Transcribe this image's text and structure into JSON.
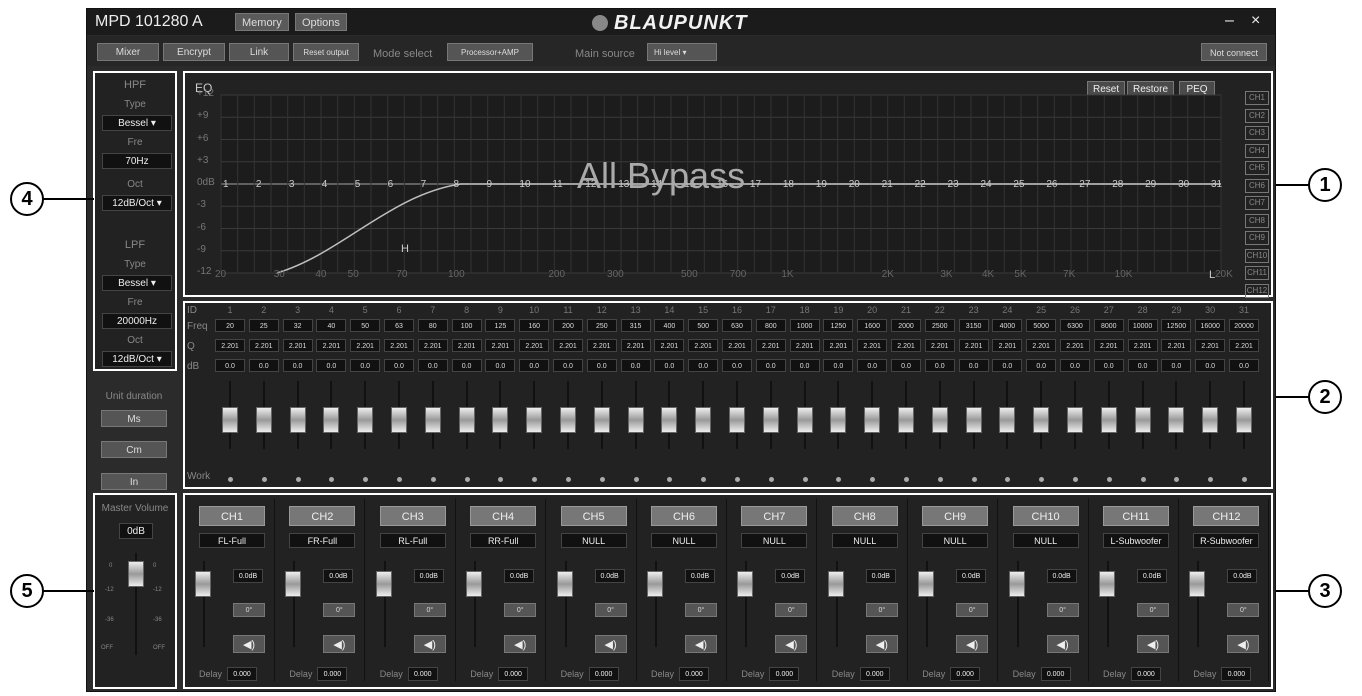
{
  "window": {
    "title": "MPD 101280 A",
    "menu": [
      "Memory",
      "Options"
    ],
    "brand": "BLAUPUNKT",
    "controls": [
      "–",
      "×"
    ]
  },
  "toolbar": {
    "buttons": [
      "Mixer",
      "Encrypt",
      "Link",
      "Reset output"
    ],
    "mode_select_label": "Mode select",
    "mode_value": "Processor+AMP",
    "main_source_label": "Main source",
    "main_source_value": "Hi level",
    "connection_status": "Not connect"
  },
  "crossover": {
    "hpf_title": "HPF",
    "hpf_type_label": "Type",
    "hpf_type": "Bessel",
    "hpf_fre_label": "Fre",
    "hpf_fre": "70Hz",
    "hpf_oct_label": "Oct",
    "hpf_oct": "12dB/Oct",
    "lpf_title": "LPF",
    "lpf_type_label": "Type",
    "lpf_type": "Bessel",
    "lpf_fre_label": "Fre",
    "lpf_fre": "20000Hz",
    "lpf_oct_label": "Oct",
    "lpf_oct": "12dB/Oct"
  },
  "unit_duration": {
    "label": "Unit duration",
    "options": [
      "Ms",
      "Cm",
      "In"
    ]
  },
  "master": {
    "label": "Master Volume",
    "value": "0dB",
    "scale_left": [
      "0",
      "-12",
      "-36",
      "OFF"
    ],
    "scale_right": [
      "0",
      "-12",
      "-36",
      "OFF"
    ]
  },
  "eq": {
    "label": "EQ",
    "buttons": [
      "Reset",
      "Restore",
      "PEQ"
    ],
    "overlay": "All Bypass",
    "y_ticks": [
      "+12",
      "+9",
      "+6",
      "+3",
      "0dB",
      "-3",
      "-6",
      "-9",
      "-12"
    ],
    "x_ticks": [
      "20",
      "30",
      "40",
      "50",
      "70",
      "100",
      "200",
      "300",
      "500",
      "700",
      "1K",
      "2K",
      "3K",
      "4K",
      "5K",
      "7K",
      "10K",
      "20K"
    ],
    "band_numbers": [
      "1",
      "2",
      "3",
      "4",
      "5",
      "6",
      "7",
      "8",
      "9",
      "10",
      "11",
      "12",
      "13",
      "14",
      "15",
      "16",
      "17",
      "18",
      "19",
      "20",
      "21",
      "22",
      "23",
      "24",
      "25",
      "26",
      "27",
      "28",
      "29",
      "30",
      "31"
    ],
    "marker_h": "H",
    "marker_l": "L",
    "channels": [
      "CH1",
      "CH2",
      "CH3",
      "CH4",
      "CH5",
      "CH6",
      "CH7",
      "CH8",
      "CH9",
      "CH10",
      "CH11",
      "CH12"
    ]
  },
  "bands": {
    "row_labels": [
      "ID",
      "Freq",
      "Q",
      "dB",
      "Work"
    ],
    "freq": [
      "20",
      "25",
      "32",
      "40",
      "50",
      "63",
      "80",
      "100",
      "125",
      "160",
      "200",
      "250",
      "315",
      "400",
      "500",
      "630",
      "800",
      "1000",
      "1250",
      "1600",
      "2000",
      "2500",
      "3150",
      "4000",
      "5000",
      "6300",
      "8000",
      "10000",
      "12500",
      "16000",
      "20000"
    ],
    "q": "2.201",
    "db": "0.0"
  },
  "channels": [
    {
      "name": "CH1",
      "route": "FL-Full",
      "gain": "0.0dB",
      "delay": "0.000"
    },
    {
      "name": "CH2",
      "route": "FR-Full",
      "gain": "0.0dB",
      "delay": "0.000"
    },
    {
      "name": "CH3",
      "route": "RL-Full",
      "gain": "0.0dB",
      "delay": "0.000"
    },
    {
      "name": "CH4",
      "route": "RR-Full",
      "gain": "0.0dB",
      "delay": "0.000"
    },
    {
      "name": "CH5",
      "route": "NULL",
      "gain": "0.0dB",
      "delay": "0.000"
    },
    {
      "name": "CH6",
      "route": "NULL",
      "gain": "0.0dB",
      "delay": "0.000"
    },
    {
      "name": "CH7",
      "route": "NULL",
      "gain": "0.0dB",
      "delay": "0.000"
    },
    {
      "name": "CH8",
      "route": "NULL",
      "gain": "0.0dB",
      "delay": "0.000"
    },
    {
      "name": "CH9",
      "route": "NULL",
      "gain": "0.0dB",
      "delay": "0.000"
    },
    {
      "name": "CH10",
      "route": "NULL",
      "gain": "0.0dB",
      "delay": "0.000"
    },
    {
      "name": "CH11",
      "route": "L-Subwoofer",
      "gain": "0.0dB",
      "delay": "0.000"
    },
    {
      "name": "CH12",
      "route": "R-Subwoofer",
      "gain": "0.0dB",
      "delay": "0.000"
    }
  ],
  "channel_strip": {
    "phase": "0°",
    "delay_label": "Delay",
    "mute_icon": "speaker-icon"
  },
  "callouts": [
    "1",
    "2",
    "3",
    "4",
    "5"
  ]
}
